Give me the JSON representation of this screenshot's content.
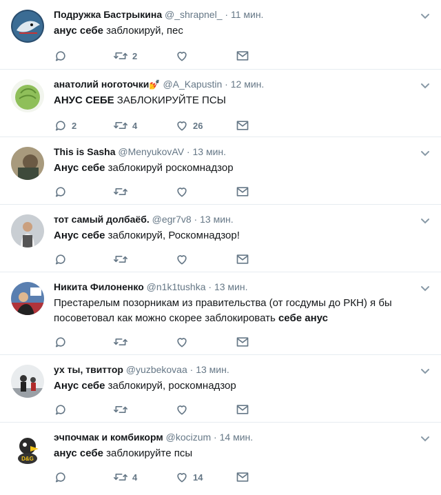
{
  "tweets": [
    {
      "name": "Подружка Бастрыкина",
      "handle": "@_shrapnel_",
      "time": "11 мин.",
      "text_parts": [
        {
          "t": "анус себе",
          "b": true
        },
        {
          "t": " заблокируй, пес",
          "b": false
        }
      ],
      "replies": "",
      "retweets": "2",
      "likes": "",
      "avatar_color": "#2a4d6e",
      "avatar_icon": "shark-avatar"
    },
    {
      "name": "анатолий ноготочки",
      "handle": "@A_Kapustin",
      "time": "12 мин.",
      "emoji": "💅",
      "text_parts": [
        {
          "t": "АНУС СЕБЕ",
          "b": true
        },
        {
          "t": " ЗАБЛОКИРУЙТЕ ПСЫ",
          "b": false
        }
      ],
      "replies": "2",
      "retweets": "4",
      "likes": "26",
      "avatar_color": "#8fbf5a",
      "avatar_icon": "cabbage-avatar"
    },
    {
      "name": "This is Sasha",
      "handle": "@MenyukovAV",
      "time": "13 мин.",
      "text_parts": [
        {
          "t": "Анус себе",
          "b": true
        },
        {
          "t": " заблокируй роскомнадзор",
          "b": false
        }
      ],
      "replies": "",
      "retweets": "",
      "likes": "",
      "avatar_color": "#6b5a44",
      "avatar_icon": "photo-avatar"
    },
    {
      "name": "тот самый долбаёб.",
      "handle": "@egr7v8",
      "time": "13 мин.",
      "text_parts": [
        {
          "t": "Анус себе",
          "b": true
        },
        {
          "t": " заблокируй, Роскомнадзор!",
          "b": false
        }
      ],
      "replies": "",
      "retweets": "",
      "likes": "",
      "avatar_color": "#c9ced3",
      "avatar_icon": "person-avatar"
    },
    {
      "name": "Никита Филоненко",
      "handle": "@n1k1tushka",
      "time": "13 мин.",
      "text_parts": [
        {
          "t": "Престарелым позорникам из правительства (от госдумы до РКН) я бы посоветовал как можно скорее заблокировать ",
          "b": false
        },
        {
          "t": "себе анус",
          "b": true
        }
      ],
      "replies": "",
      "retweets": "",
      "likes": "",
      "avatar_color": "#b0343a",
      "avatar_icon": "flag-avatar"
    },
    {
      "name": "ух ты, твиттор",
      "handle": "@yuzbekovaa",
      "time": "13 мин.",
      "text_parts": [
        {
          "t": "Анус себе",
          "b": true
        },
        {
          "t": " заблокируй, роскомнадзор",
          "b": false
        }
      ],
      "replies": "",
      "retweets": "",
      "likes": "",
      "avatar_color": "#9aa0a6",
      "avatar_icon": "people-avatar"
    },
    {
      "name": "эчпочмак и комбикорм",
      "handle": "@kocizum",
      "time": "14 мин.",
      "text_parts": [
        {
          "t": "анус себе",
          "b": true
        },
        {
          "t": " заблокируйте псы",
          "b": false
        }
      ],
      "replies": "",
      "retweets": "4",
      "likes": "14",
      "avatar_color": "#f5c518",
      "avatar_icon": "bird-avatar"
    }
  ],
  "colors": {
    "icon": "#657786",
    "text": "#14171a",
    "muted": "#657786",
    "divider": "#e6ecf0"
  }
}
